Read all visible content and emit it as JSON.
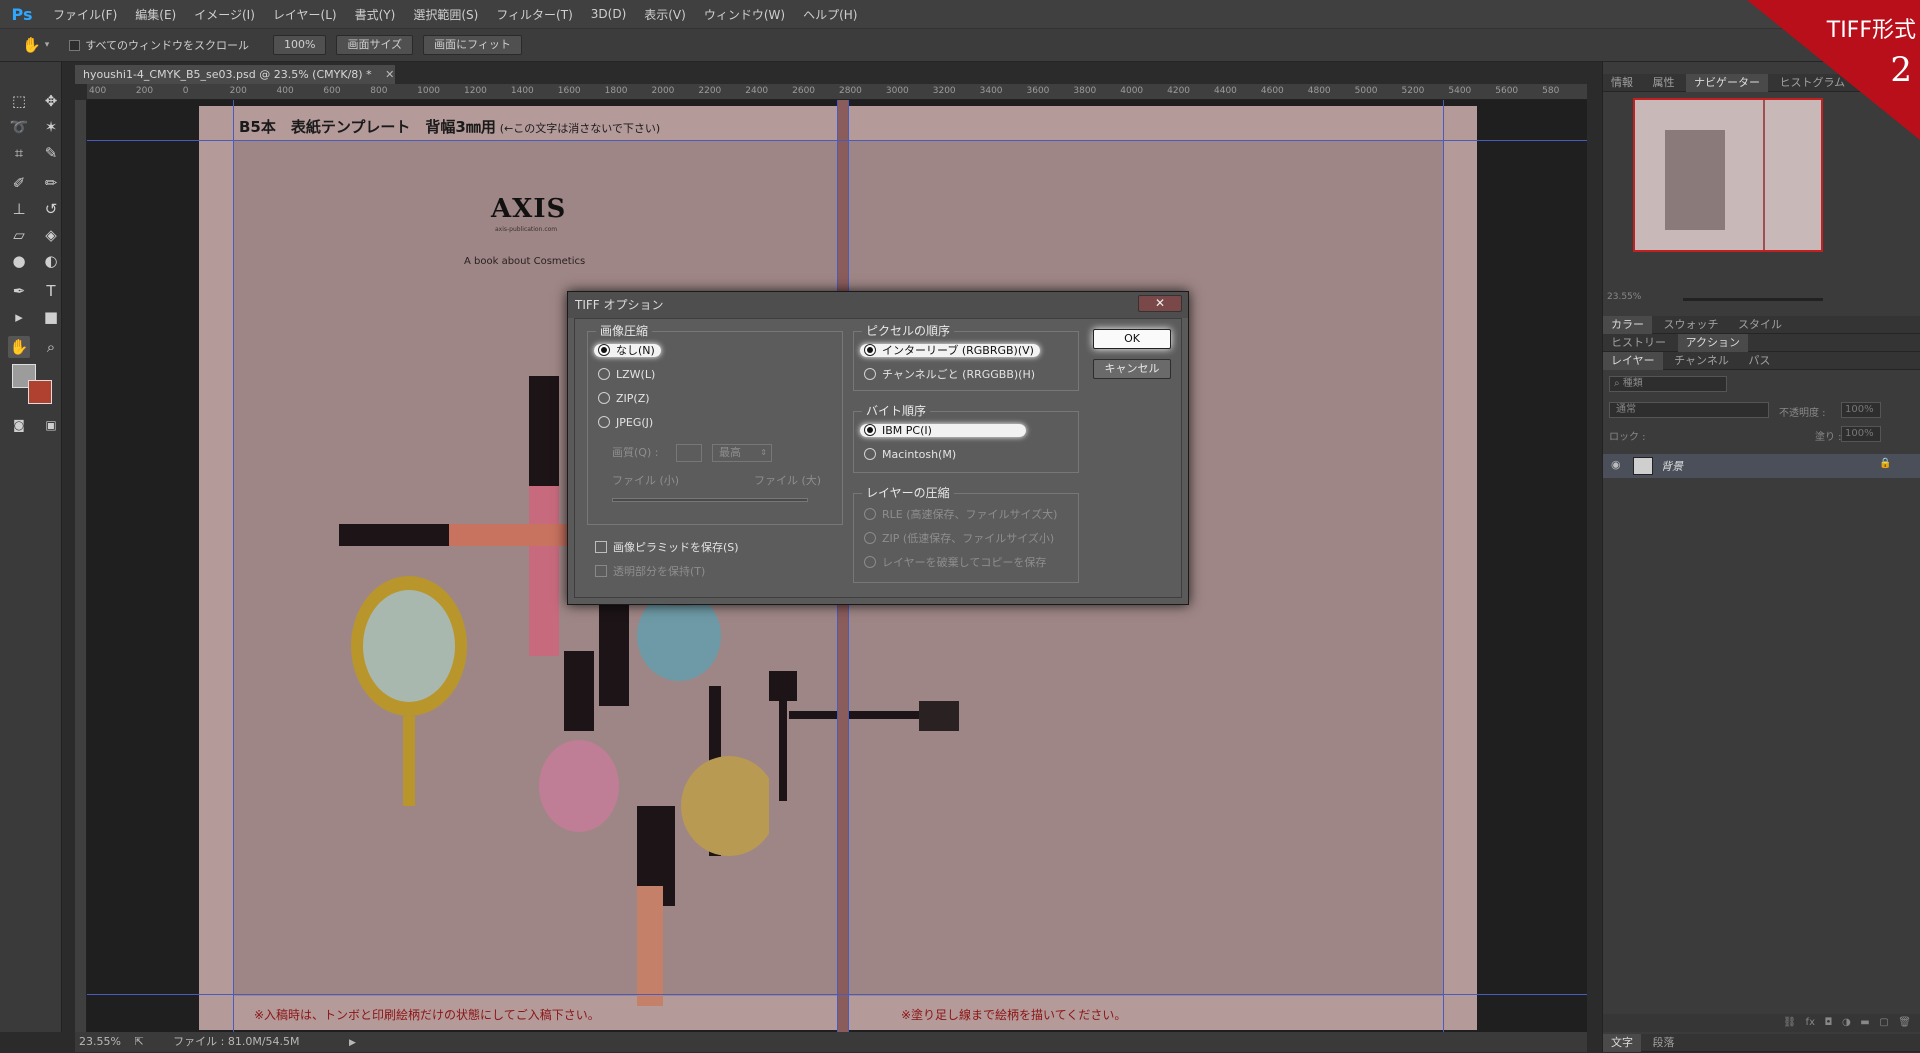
{
  "menubar": {
    "logo": "Ps",
    "items": [
      "ファイル(F)",
      "編集(E)",
      "イメージ(I)",
      "レイヤー(L)",
      "書式(Y)",
      "選択範囲(S)",
      "フィルター(T)",
      "3D(D)",
      "表示(V)",
      "ウィンドウ(W)",
      "ヘルプ(H)"
    ]
  },
  "optionsbar": {
    "scroll_all_label": "すべてのウィンドウをスクロール",
    "zoom_button": "100%",
    "fit_screen_button": "画面サイズ",
    "fill_screen_button": "画面にフィット"
  },
  "document": {
    "tab_title": "hyoushi1-4_CMYK_B5_se03.psd @ 23.5% (CMYK/8) *",
    "header_text": "B5本　表紙テンプレート　背幅3㎜用",
    "header_note": "(←この文字は消さないで下さい)",
    "brand": "AXIS",
    "brand_sub": "axis-publication.com",
    "tagline": "A  book about  Cosmetics",
    "footer_left": "※入稿時は、トンボと印刷絵柄だけの状態にしてご入稿下さい。",
    "footer_right": "※塗り足し線まで絵柄を描いてください。"
  },
  "ruler_h": [
    "400",
    "200",
    "0",
    "200",
    "400",
    "600",
    "800",
    "1000",
    "1200",
    "1400",
    "1600",
    "1800",
    "2000",
    "2200",
    "2400",
    "2600",
    "2800",
    "3000",
    "3200",
    "3400",
    "3600",
    "3800",
    "4000",
    "4200",
    "4400",
    "4600",
    "4800",
    "5000",
    "5200",
    "5400",
    "5600",
    "580"
  ],
  "statusbar": {
    "zoom": "23.55%",
    "file_info": "ファイル : 81.0M/54.5M"
  },
  "right_panel": {
    "top_tabs": [
      "情報",
      "属性",
      "ナビゲーター",
      "ヒストグラム"
    ],
    "nav_zoom": "23.55%",
    "color_tabs": [
      "カラー",
      "スウォッチ",
      "スタイル"
    ],
    "history_tabs": [
      "ヒストリー",
      "アクション"
    ],
    "layer_tabs": [
      "レイヤー",
      "チャンネル",
      "パス"
    ],
    "filter_label": "種類",
    "blend_mode": "通常",
    "opacity_label": "不透明度 :",
    "opacity_value": "100%",
    "lock_label": "ロック :",
    "fill_label": "塗り :",
    "fill_value": "100%",
    "layer_name": "背景",
    "bottom_tabs": [
      "文字",
      "段落"
    ]
  },
  "dialog": {
    "title": "TIFF オプション",
    "close_label": "✕",
    "compression": {
      "title": "画像圧縮",
      "options": [
        "なし(N)",
        "LZW(L)",
        "ZIP(Z)",
        "JPEG(J)"
      ],
      "selected": "なし(N)",
      "quality_label": "画質(Q) :",
      "quality_value": "最高",
      "small_label": "ファイル (小)",
      "large_label": "ファイル (大)"
    },
    "pixel_order": {
      "title": "ピクセルの順序",
      "options": [
        "インターリーブ (RGBRGB)(V)",
        "チャンネルごと (RRGGBB)(H)"
      ],
      "selected": "インターリーブ (RGBRGB)(V)"
    },
    "byte_order": {
      "title": "バイト順序",
      "options": [
        "IBM PC(I)",
        "Macintosh(M)"
      ],
      "selected": "IBM PC(I)"
    },
    "layer_compression": {
      "title": "レイヤーの圧縮",
      "options": [
        "RLE (高速保存、ファイルサイズ大)",
        "ZIP (低速保存、ファイルサイズ小)",
        "レイヤーを破棄してコピーを保存"
      ]
    },
    "save_pyramid": "画像ピラミッドを保存(S)",
    "save_transparency": "透明部分を保持(T)",
    "ok_label": "OK",
    "cancel_label": "キャンセル"
  },
  "badge": {
    "title": "TIFF形式",
    "number": "2",
    "color": "#b80f1a"
  }
}
